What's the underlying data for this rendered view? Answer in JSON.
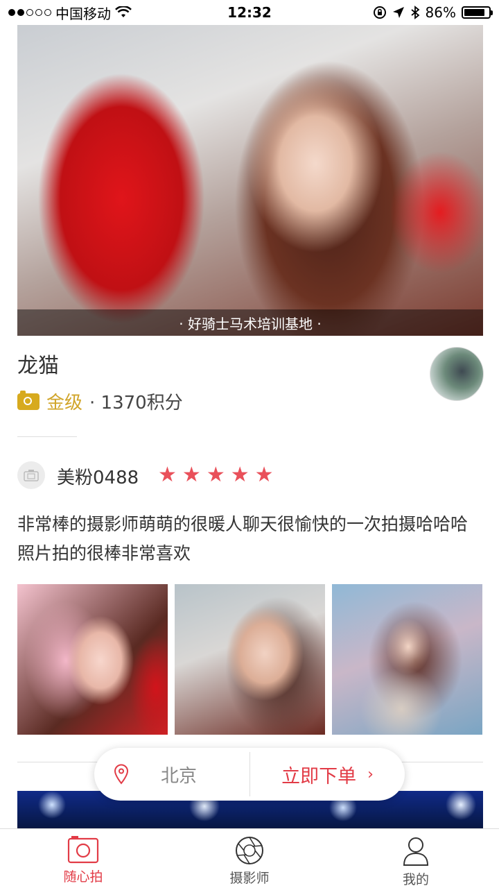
{
  "status_bar": {
    "carrier": "中国移动",
    "time": "12:32",
    "battery": "86%",
    "battery_level": 0.86
  },
  "hero": {
    "caption": "· 好骑士马术培训基地 ·"
  },
  "photographer": {
    "name": "龙猫",
    "level": "金级",
    "points": "· 1370积分"
  },
  "review": {
    "reviewer": "美粉0488",
    "rating": 5,
    "stars": [
      "★",
      "★",
      "★",
      "★",
      "★"
    ],
    "text": "非常棒的摄影师萌萌的很暖人聊天很愉快的一次拍摄哈哈哈照片拍的很棒非常喜欢"
  },
  "booking": {
    "city": "北京",
    "order_label": "立即下单",
    "chevron": "›"
  },
  "tabbar": {
    "tabs": [
      {
        "label": "随心拍",
        "icon": "camera-icon",
        "active": true
      },
      {
        "label": "摄影师",
        "icon": "aperture-icon",
        "active": false
      },
      {
        "label": "我的",
        "icon": "user-icon",
        "active": false
      }
    ]
  },
  "colors": {
    "accent": "#e23b46",
    "gold": "#d1a52a",
    "star": "#e9505a"
  }
}
